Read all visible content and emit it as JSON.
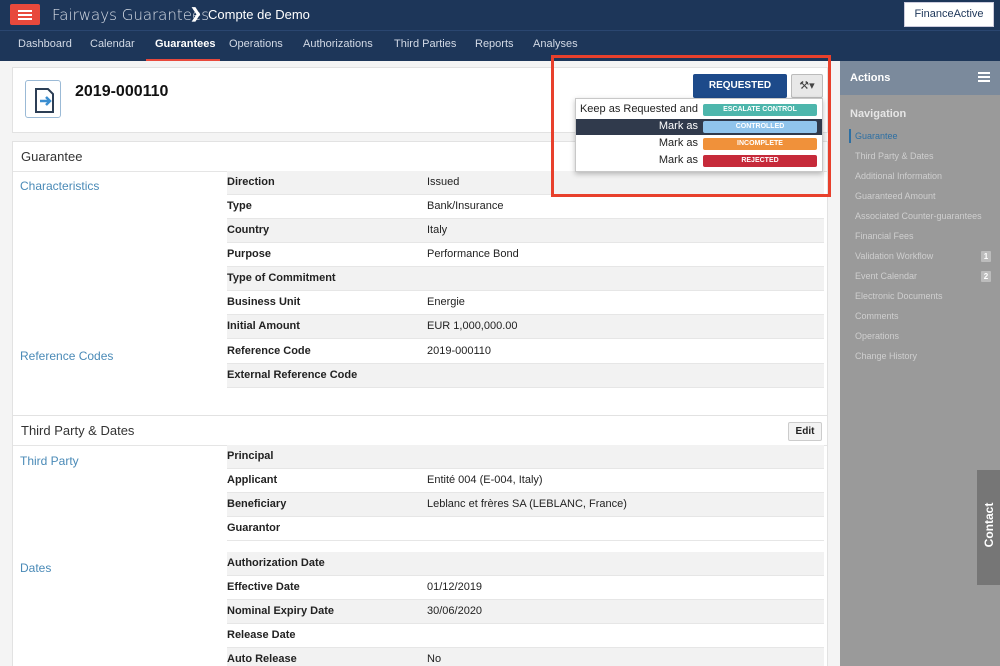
{
  "header": {
    "app_title": "Fairways Guarantees",
    "crumb_sep": "❯",
    "breadcrumb": "Compte de Demo",
    "brand": "FinanceActive"
  },
  "nav": {
    "items": [
      "Dashboard",
      "Calendar",
      "Guarantees",
      "Operations",
      "Authorizations",
      "Third Parties",
      "Reports",
      "Analyses"
    ],
    "active": "Guarantees"
  },
  "record": {
    "id": "2019-000110",
    "status_button": "REQUESTED",
    "tool_button": "⚒▾"
  },
  "dropdown": {
    "items": [
      {
        "label": "Keep as Requested and",
        "badge": "ESCALATE CONTROL",
        "color": "#4db6ac"
      },
      {
        "label": "Mark as",
        "badge": "CONTROLLED",
        "color": "#90c4ec"
      },
      {
        "label": "Mark as",
        "badge": "INCOMPLETE",
        "color": "#f0913a"
      },
      {
        "label": "Mark as",
        "badge": "REJECTED",
        "color": "#c62a3a"
      }
    ]
  },
  "guarantee": {
    "title": "Guarantee",
    "group_characteristics": "Characteristics",
    "group_reference": "Reference Codes",
    "rows": [
      {
        "key": "Direction",
        "value": "Issued"
      },
      {
        "key": "Type",
        "value": "Bank/Insurance"
      },
      {
        "key": "Country",
        "value": "Italy"
      },
      {
        "key": "Purpose",
        "value": "Performance Bond"
      },
      {
        "key": "Type of Commitment",
        "value": ""
      },
      {
        "key": "Business Unit",
        "value": "Energie"
      },
      {
        "key": "Initial Amount",
        "value": "EUR 1,000,000.00"
      },
      {
        "key": "Reference Code",
        "value": "2019-000110"
      },
      {
        "key": "External Reference Code",
        "value": ""
      }
    ]
  },
  "third_party": {
    "title": "Third Party & Dates",
    "edit": "Edit",
    "group_third_party": "Third Party",
    "group_dates": "Dates",
    "party_rows": [
      {
        "key": "Principal",
        "value": ""
      },
      {
        "key": "Applicant",
        "value": "Entité 004 (E-004, Italy)"
      },
      {
        "key": "Beneficiary",
        "value": "Leblanc et frères SA (LEBLANC, France)"
      },
      {
        "key": "Guarantor",
        "value": ""
      }
    ],
    "date_rows": [
      {
        "key": "Authorization Date",
        "value": ""
      },
      {
        "key": "Effective Date",
        "value": "01/12/2019"
      },
      {
        "key": "Nominal Expiry Date",
        "value": "30/06/2020"
      },
      {
        "key": "Release Date",
        "value": ""
      },
      {
        "key": "Auto Release",
        "value": "No"
      }
    ]
  },
  "sidebar": {
    "actions": "Actions",
    "navigation": "Navigation",
    "items": [
      {
        "label": "Guarantee",
        "badge": ""
      },
      {
        "label": "Third Party & Dates",
        "badge": ""
      },
      {
        "label": "Additional Information",
        "badge": ""
      },
      {
        "label": "Guaranteed Amount",
        "badge": ""
      },
      {
        "label": "Associated Counter-guarantees",
        "badge": ""
      },
      {
        "label": "Financial Fees",
        "badge": ""
      },
      {
        "label": "Validation Workflow",
        "badge": "1"
      },
      {
        "label": "Event Calendar",
        "badge": "2"
      },
      {
        "label": "Electronic Documents",
        "badge": ""
      },
      {
        "label": "Comments",
        "badge": ""
      },
      {
        "label": "Operations",
        "badge": ""
      },
      {
        "label": "Change History",
        "badge": ""
      }
    ],
    "contact": "Contact"
  }
}
